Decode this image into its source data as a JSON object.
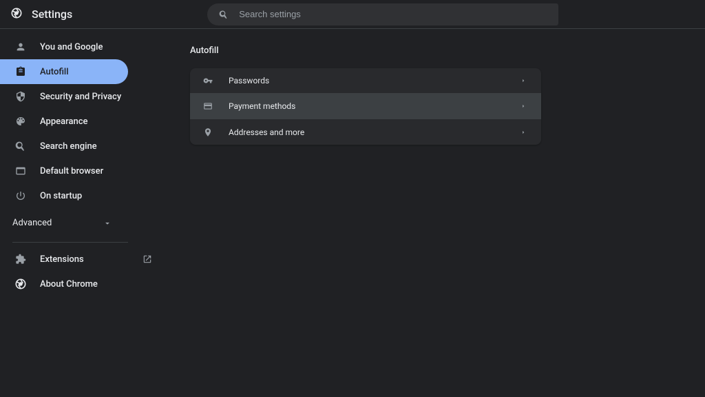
{
  "app_title": "Settings",
  "search": {
    "placeholder": "Search settings"
  },
  "sidebar": {
    "items": [
      {
        "id": "you-and-google",
        "label": "You and Google"
      },
      {
        "id": "autofill",
        "label": "Autofill"
      },
      {
        "id": "security-privacy",
        "label": "Security and Privacy"
      },
      {
        "id": "appearance",
        "label": "Appearance"
      },
      {
        "id": "search-engine",
        "label": "Search engine"
      },
      {
        "id": "default-browser",
        "label": "Default browser"
      },
      {
        "id": "on-startup",
        "label": "On startup"
      }
    ],
    "advanced_label": "Advanced",
    "footer": [
      {
        "id": "extensions",
        "label": "Extensions"
      },
      {
        "id": "about-chrome",
        "label": "About Chrome"
      }
    ],
    "active_id": "autofill"
  },
  "main": {
    "title": "Autofill",
    "rows": [
      {
        "id": "passwords",
        "label": "Passwords"
      },
      {
        "id": "payment-methods",
        "label": "Payment methods"
      },
      {
        "id": "addresses",
        "label": "Addresses and more"
      }
    ],
    "hover_id": "payment-methods"
  }
}
